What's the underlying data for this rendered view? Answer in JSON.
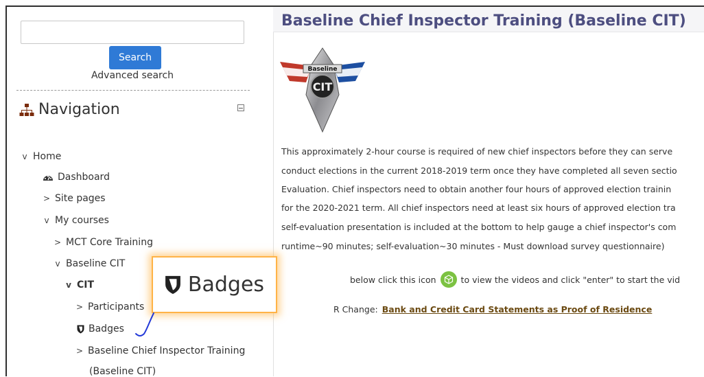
{
  "sidebar": {
    "search": {
      "button_label": "Search",
      "advanced_link": "Advanced search",
      "value": "",
      "placeholder": ""
    },
    "navigation": {
      "title": "Navigation",
      "items": [
        {
          "label": "Home",
          "chevron": "v",
          "icon": ""
        },
        {
          "label": "Dashboard",
          "chevron": "",
          "icon": "dashboard-icon"
        },
        {
          "label": "Site pages",
          "chevron": ">",
          "icon": ""
        },
        {
          "label": "My courses",
          "chevron": "v",
          "icon": ""
        },
        {
          "label": "MCT Core Training",
          "chevron": ">",
          "icon": ""
        },
        {
          "label": "Baseline CIT",
          "chevron": "v",
          "icon": ""
        },
        {
          "label": "CIT",
          "chevron": "v",
          "icon": ""
        },
        {
          "label": "Participants",
          "chevron": ">",
          "icon": ""
        },
        {
          "label": "Badges",
          "chevron": "",
          "icon": "shield-icon"
        },
        {
          "label": "Baseline Chief Inspector Training",
          "chevron": ">",
          "icon": ""
        },
        {
          "label": "(Baseline CIT)",
          "chevron": "",
          "icon": ""
        }
      ]
    }
  },
  "main": {
    "title": "Baseline Chief Inspector Training (Baseline CIT)",
    "logo": {
      "banner_text": "Baseline",
      "center_text": "CIT"
    },
    "paragraph_lines": [
      "This approximately 2-hour course is required of new chief inspectors before they can serve",
      "conduct elections in the current 2018-2019 term once they have completed all seven sectio",
      "Evaluation.  Chief inspectors need to obtain another four hours of approved election trainin",
      "for the 2020-2021 term.  All chief inspectors need at least six hours of approved election tra",
      "self-evaluation presentation is included at the bottom to help gauge a chief inspector's com",
      "runtime~90 minutes; self-evaluation~30 minutes - Must download survey questionnaire)"
    ],
    "icon_instruction": {
      "before": "below click this icon",
      "after": "to view the videos and click \"enter\" to start the vid"
    },
    "change": {
      "prefix": "R Change:",
      "link": "Bank and Credit Card Statements as Proof of Residence"
    }
  },
  "callout": {
    "label": "Badges",
    "icon": "shield-icon"
  },
  "colors": {
    "title": "#4d4e80",
    "search_button": "#2f7ad6",
    "callout_border": "#ffb346",
    "link": "#6b4a12",
    "cube_icon": "#7cc242"
  }
}
